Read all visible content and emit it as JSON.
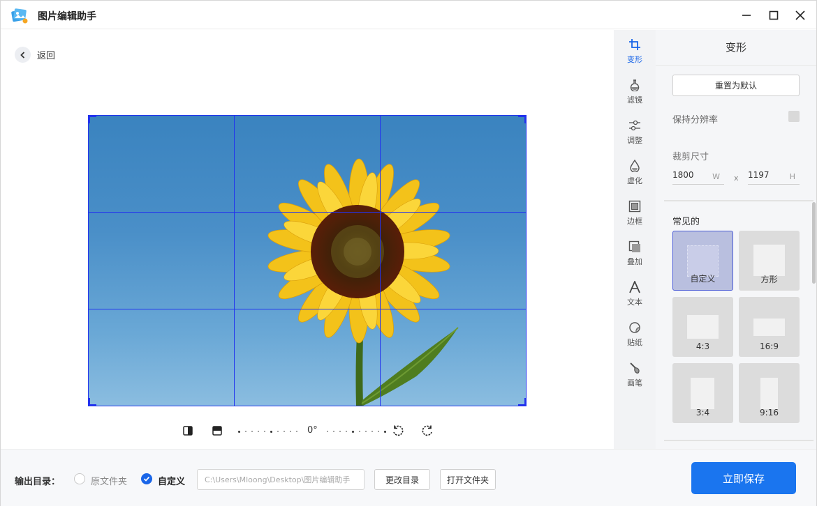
{
  "app": {
    "title": "图片编辑助手"
  },
  "nav": {
    "back_label": "返回"
  },
  "image_toolbar": {
    "angle": "0°"
  },
  "rail": {
    "items": [
      {
        "label": "变形",
        "icon": "crop-icon",
        "active": true
      },
      {
        "label": "滤镜",
        "icon": "filter-flask-icon",
        "active": false
      },
      {
        "label": "调整",
        "icon": "adjust-sliders-icon",
        "active": false
      },
      {
        "label": "虚化",
        "icon": "blur-drop-icon",
        "active": false
      },
      {
        "label": "边框",
        "icon": "border-frame-icon",
        "active": false
      },
      {
        "label": "叠加",
        "icon": "overlay-icon",
        "active": false
      },
      {
        "label": "文本",
        "icon": "text-icon",
        "active": false
      },
      {
        "label": "贴纸",
        "icon": "sticker-icon",
        "active": false
      },
      {
        "label": "画笔",
        "icon": "brush-icon",
        "active": false
      }
    ]
  },
  "panel": {
    "title": "变形",
    "reset_label": "重置为默认",
    "keep_resolution_label": "保持分辨率",
    "crop_size_label": "裁剪尺寸",
    "width_value": "1800",
    "width_unit": "W",
    "separator": "x",
    "height_value": "1197",
    "height_unit": "H",
    "common_label": "常见的",
    "presets": [
      {
        "label": "自定义",
        "active": true
      },
      {
        "label": "方形",
        "active": false
      },
      {
        "label": "4:3",
        "active": false
      },
      {
        "label": "16:9",
        "active": false
      },
      {
        "label": "3:4",
        "active": false
      },
      {
        "label": "9:16",
        "active": false
      }
    ]
  },
  "footer": {
    "output_label": "输出目录：",
    "option_original": "原文件夹",
    "option_custom": "自定义",
    "path_value": "C:\\Users\\Mloong\\Desktop\\图片编辑助手",
    "change_dir_label": "更改目录",
    "open_folder_label": "打开文件夹",
    "save_label": "立即保存"
  },
  "colors": {
    "accent": "#1a75ef",
    "grid": "#2233ee",
    "active_preset": "#b9bfdf"
  }
}
